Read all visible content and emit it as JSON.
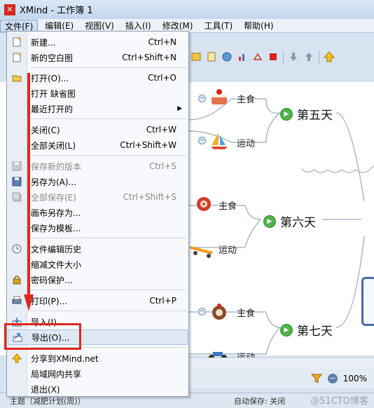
{
  "window": {
    "title": "XMind - 工作簿 1",
    "logo_letter": "✕"
  },
  "menubar": {
    "items": [
      "文件(F)",
      "编辑(E)",
      "视图(V)",
      "插入(I)",
      "修改(M)",
      "工具(T)",
      "帮助(H)"
    ]
  },
  "file_menu": {
    "items": [
      {
        "label": "新建...",
        "shortcut": "Ctrl+N",
        "icon": "new-file-icon",
        "enabled": true
      },
      {
        "label": "新的空白图",
        "shortcut": "Ctrl+Shift+N",
        "icon": "blank-map-icon",
        "enabled": true
      },
      {
        "label": "打开(O)...",
        "shortcut": "Ctrl+O",
        "icon": "folder-open-icon",
        "enabled": true
      },
      {
        "label": "打开 缺省图",
        "shortcut": "",
        "icon": "",
        "enabled": true
      },
      {
        "label": "最近打开的",
        "shortcut": "",
        "icon": "",
        "enabled": true,
        "submenu": true
      },
      {
        "label": "关闭(C)",
        "shortcut": "Ctrl+W",
        "icon": "",
        "enabled": true
      },
      {
        "label": "全部关闭(L)",
        "shortcut": "Ctrl+Shift+W",
        "icon": "",
        "enabled": true
      },
      {
        "label": "保存新的版本",
        "shortcut": "Ctrl+S",
        "icon": "save-icon",
        "enabled": false
      },
      {
        "label": "另存为(A)...",
        "shortcut": "",
        "icon": "save-as-icon",
        "enabled": true
      },
      {
        "label": "全部保存(E)",
        "shortcut": "Ctrl+Shift+S",
        "icon": "save-all-icon",
        "enabled": false
      },
      {
        "label": "画布另存为...",
        "shortcut": "",
        "icon": "",
        "enabled": true
      },
      {
        "label": "保存为模板...",
        "shortcut": "",
        "icon": "",
        "enabled": true
      },
      {
        "label": "文件编辑历史",
        "shortcut": "",
        "icon": "history-icon",
        "enabled": true
      },
      {
        "label": "缩减文件大小",
        "shortcut": "",
        "icon": "",
        "enabled": true
      },
      {
        "label": "密码保护...",
        "shortcut": "",
        "icon": "lock-icon",
        "enabled": true
      },
      {
        "label": "打印(P)...",
        "shortcut": "Ctrl+P",
        "icon": "printer-icon",
        "enabled": true
      },
      {
        "label": "导入(I)...",
        "shortcut": "",
        "icon": "import-icon",
        "enabled": true
      },
      {
        "label": "导出(O)...",
        "shortcut": "",
        "icon": "export-icon",
        "enabled": true,
        "highlighted": true
      },
      {
        "label": "分享到XMind.net",
        "shortcut": "",
        "icon": "share-icon",
        "enabled": true
      },
      {
        "label": "局域网内共享",
        "shortcut": "",
        "icon": "",
        "enabled": true
      },
      {
        "label": "退出(X)",
        "shortcut": "",
        "icon": "",
        "enabled": true
      }
    ]
  },
  "mindmap": {
    "days": [
      "第五天",
      "第六天",
      "第七天"
    ],
    "subtopics": [
      "主食",
      "运动",
      "主食",
      "运动",
      "主食",
      "运动"
    ]
  },
  "zoom": {
    "value": "100%"
  },
  "status": {
    "sheet": "主题（减肥计划(周)）",
    "autosave": "自动保存: 关闭"
  },
  "watermark": "@51CTO博客",
  "colors": {
    "annotation_red": "#e0271f",
    "menu_highlight": "#dfe9f6",
    "day_play_green": "#4fb24a"
  }
}
